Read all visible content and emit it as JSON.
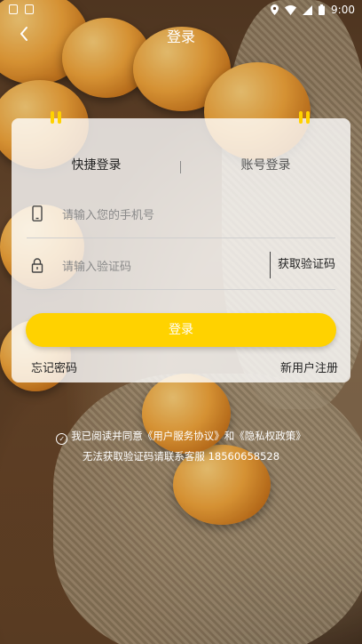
{
  "status_bar": {
    "time": "9:00"
  },
  "header": {
    "title": "登录",
    "back_icon": "chevron-left-icon"
  },
  "tabs": [
    {
      "label": "快捷登录"
    },
    {
      "label": "账号登录"
    }
  ],
  "form": {
    "phone": {
      "placeholder": "请输入您的手机号",
      "value": "",
      "icon": "phone-icon"
    },
    "code": {
      "placeholder": "请输入验证码",
      "value": "",
      "icon": "lock-icon"
    },
    "get_code_label": "获取验证码",
    "login_label": "登录",
    "forgot_label": "忘记密码",
    "register_label": "新用户注册"
  },
  "agreement": {
    "prefix": "我已阅读并同意",
    "user_agreement": "《用户服务协议》",
    "and": "和",
    "privacy_policy": "《隐私权政策》"
  },
  "contact": "无法获取验证码请联系客服 18560658528",
  "colors": {
    "accent": "#ffd200"
  }
}
